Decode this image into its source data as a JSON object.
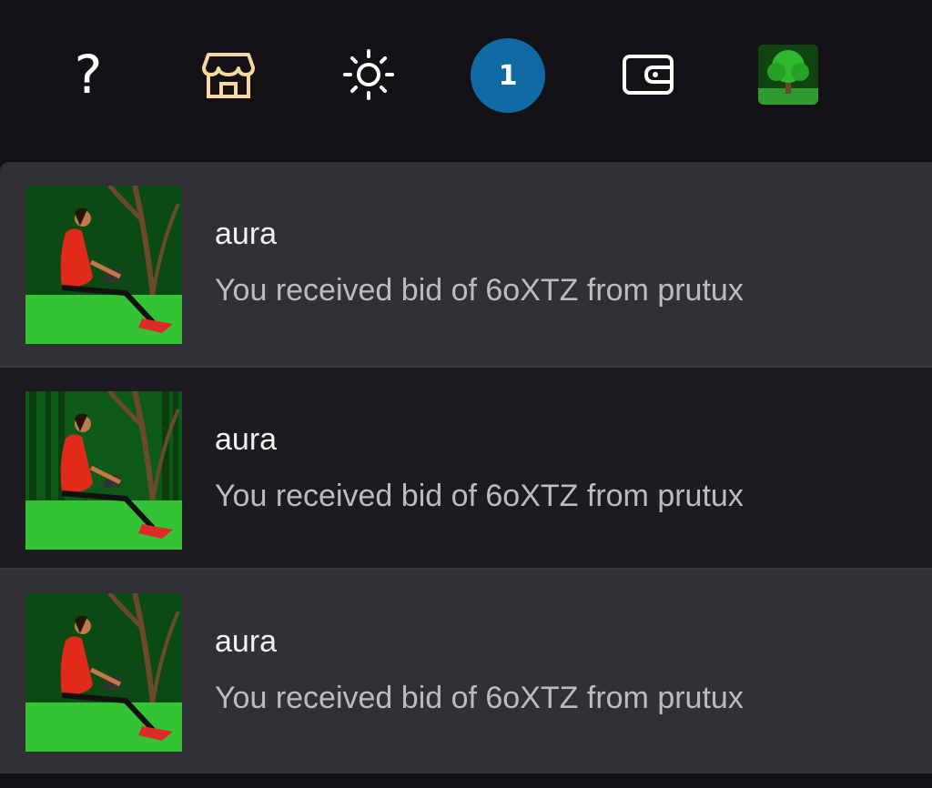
{
  "topbar": {
    "help_symbol": "?",
    "notification_count": "1",
    "icons": [
      "help-icon",
      "store-icon",
      "sun-icon",
      "notification-badge",
      "wallet-icon",
      "tree-avatar"
    ]
  },
  "notifications": [
    {
      "title": "aura",
      "message": "You received bid of 6oXTZ from prutux"
    },
    {
      "title": "aura",
      "message": "You received bid of 6oXTZ from prutux"
    },
    {
      "title": "aura",
      "message": "You received bid of 6oXTZ from prutux"
    }
  ],
  "colors": {
    "background": "#131115",
    "row_light": "#323036",
    "row_dark": "#1d1b20",
    "badge": "#0f6aa6",
    "store_accent": "#f6d8a0",
    "text_primary": "#f2f2f2",
    "text_secondary": "#bdbbc0"
  }
}
